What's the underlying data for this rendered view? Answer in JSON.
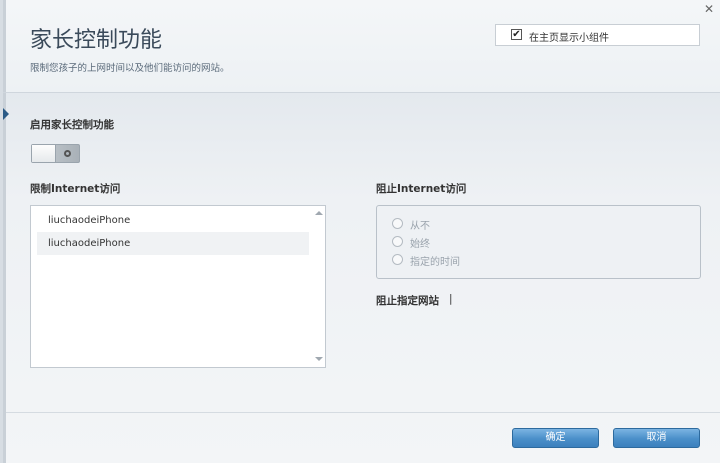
{
  "header": {
    "title": "家长控制功能",
    "subtitle": "限制您孩子的上网时间以及他们能访问的网站。",
    "widget_label": "在主页显示小组件",
    "widget_checked": true
  },
  "enable_section": {
    "label": "启用家长控制功能",
    "toggle_state": "off"
  },
  "restrict_section": {
    "label": "限制Internet访问",
    "devices": [
      "liuchaodeiPhone",
      "liuchaodeiPhone"
    ]
  },
  "block_section": {
    "label": "阻止Internet访问",
    "options": [
      "从不",
      "始终",
      "指定的时间"
    ],
    "sites_label": "阻止指定网站",
    "sites_divider": "|"
  },
  "buttons": {
    "ok": "确定",
    "cancel": "取消"
  },
  "colors": {
    "accent": "#4a8fc9",
    "title": "#3a4a5a"
  }
}
